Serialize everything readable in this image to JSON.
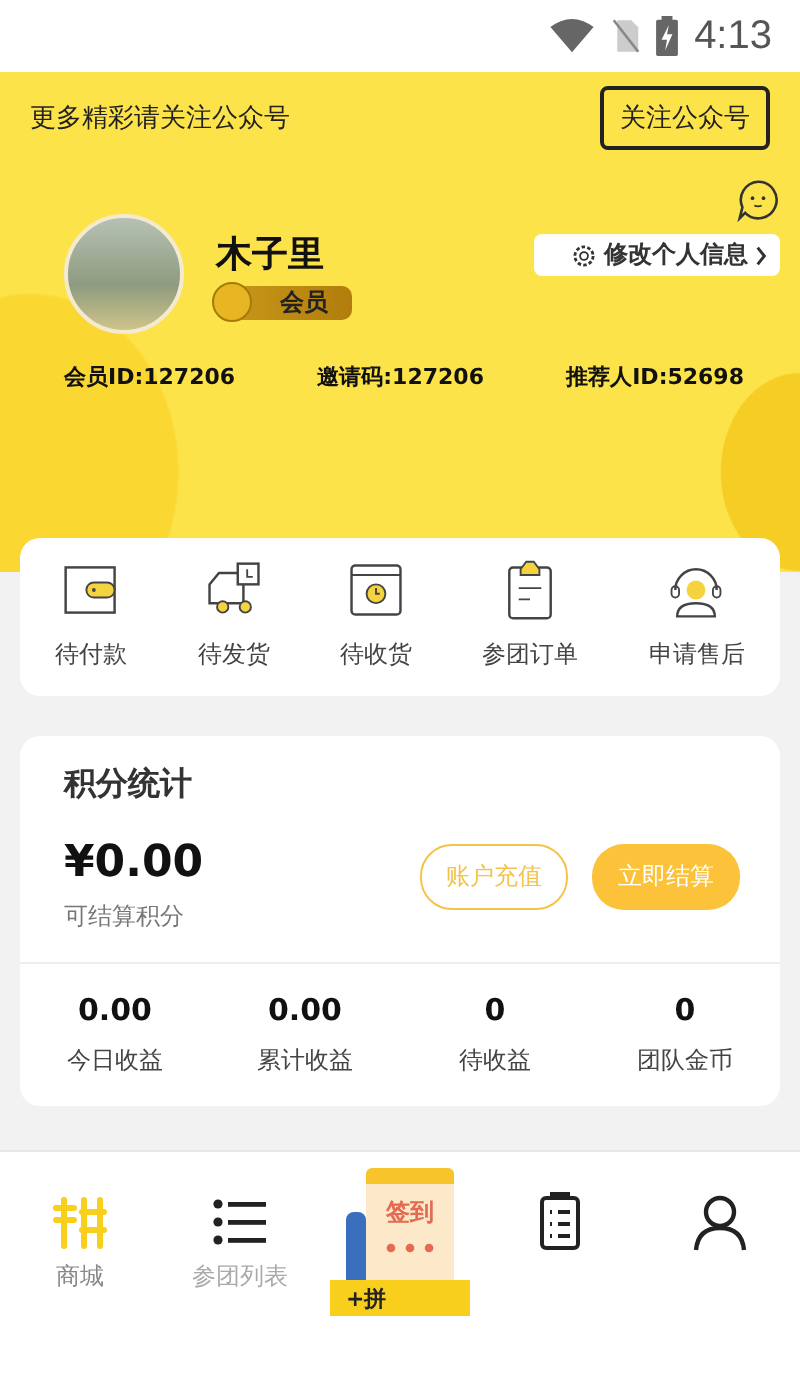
{
  "status_bar": {
    "time": "4:13"
  },
  "banner": {
    "text": "更多精彩请关注公众号",
    "button": "关注公众号"
  },
  "profile": {
    "name": "木子里",
    "badge": "会员",
    "edit": "修改个人信息",
    "ids": [
      "会员ID:127206",
      "邀请码:127206",
      "推荐人ID:52698"
    ]
  },
  "orders": [
    {
      "label": "待付款",
      "kind": "wallet"
    },
    {
      "label": "待发货",
      "kind": "truck"
    },
    {
      "label": "待收货",
      "kind": "box"
    },
    {
      "label": "参团订单",
      "kind": "clipboard"
    },
    {
      "label": "申请售后",
      "kind": "support"
    }
  ],
  "points": {
    "title": "积分统计",
    "amount": "¥0.00",
    "caption": "可结算积分",
    "buttons": [
      {
        "label": "账户充值",
        "kind": "outline"
      },
      {
        "label": "立即结算",
        "kind": "filled"
      }
    ],
    "stats": [
      {
        "value": "0.00",
        "label": "今日收益"
      },
      {
        "value": "0.00",
        "label": "累计收益"
      },
      {
        "value": "0",
        "label": "待收益"
      },
      {
        "value": "0",
        "label": "团队金币"
      }
    ]
  },
  "tabbar": [
    {
      "kind": "mall",
      "label": "商城",
      "selected": true
    },
    {
      "kind": "list",
      "label": "参团列表",
      "selected": false
    },
    {
      "kind": "signin",
      "title": "签到",
      "ribbon": "+拼"
    },
    {
      "kind": "notes",
      "selected": false
    },
    {
      "kind": "person",
      "selected": false
    }
  ]
}
